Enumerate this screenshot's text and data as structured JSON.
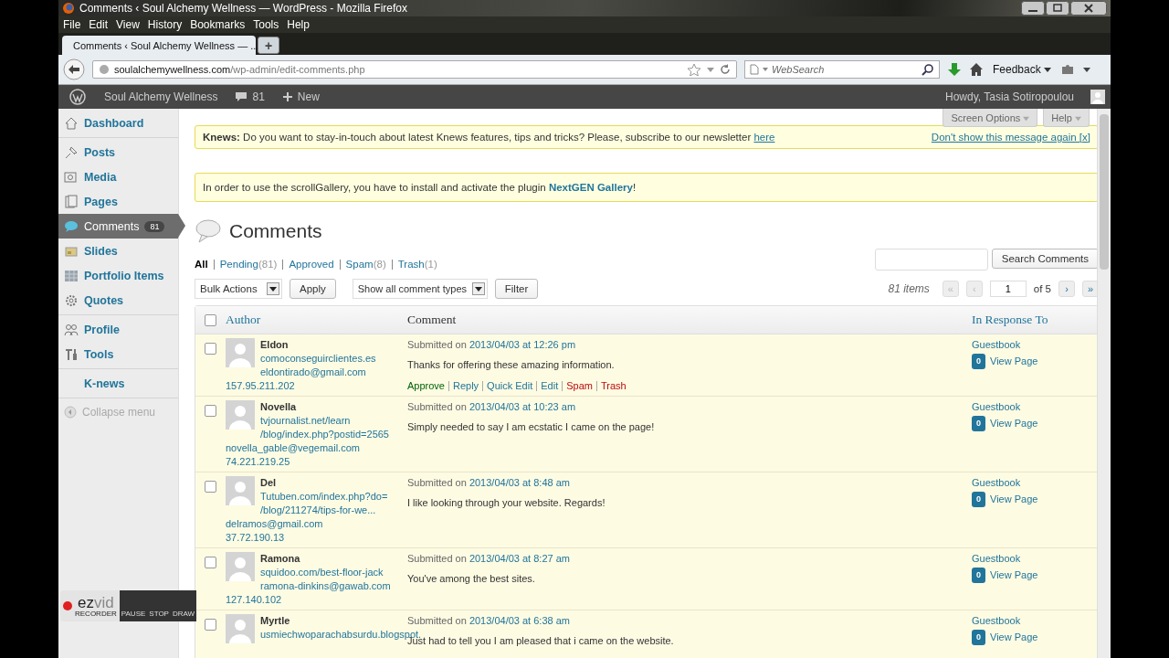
{
  "window": {
    "title": "Comments ‹ Soul Alchemy Wellness — WordPress - Mozilla Firefox"
  },
  "menu": [
    "File",
    "Edit",
    "View",
    "History",
    "Bookmarks",
    "Tools",
    "Help"
  ],
  "tabs": [
    {
      "label": "Comments ‹ Soul Alchemy Wellness — ...",
      "selected": true
    }
  ],
  "new_tab": "+",
  "address": {
    "host": "soulalchemywellness.com",
    "path": "/wp-admin/edit-comments.php"
  },
  "search": {
    "placeholder": "WebSearch"
  },
  "feedback": "Feedback",
  "admin_bar": {
    "site": "Soul Alchemy Wellness",
    "comments": "81",
    "new": "New",
    "greeting": "Howdy, Tasia Sotiropoulou"
  },
  "sidebar": {
    "groups": [
      [
        {
          "label": "Dashboard",
          "selected": false
        }
      ],
      [
        {
          "label": "Posts",
          "selected": false
        },
        {
          "label": "Media",
          "selected": false
        },
        {
          "label": "Pages",
          "selected": false
        },
        {
          "label": "Comments",
          "badge": "81",
          "selected": true
        },
        {
          "label": "Slides",
          "selected": false
        },
        {
          "label": "Portfolio Items",
          "selected": false
        },
        {
          "label": "Quotes",
          "selected": false
        }
      ],
      [
        {
          "label": "Profile",
          "selected": false
        },
        {
          "label": "Tools",
          "selected": false
        }
      ],
      [
        {
          "label": "K-news",
          "selected": false
        }
      ]
    ],
    "collapse": "Collapse menu"
  },
  "help_tabs": [
    "Screen Options",
    "Help"
  ],
  "notices": [
    {
      "kind": "knews",
      "label": "Knews:",
      "text": "Do you want to stay-in-touch about latest Knews features, tips and tricks? Please, subscribe to our newsletter",
      "link": "here",
      "dismiss": "Don't show this message again [x]"
    },
    {
      "kind": "plugin",
      "text": "In order to use the scrollGallery, you have to install and activate the plugin",
      "link": "NextGEN Gallery",
      "suffix": "!"
    }
  ],
  "heading": "Comments",
  "filters": [
    {
      "label": "All",
      "selected": true
    },
    {
      "label": "Pending",
      "count": "(81)",
      "selected": false
    },
    {
      "label": "Approved",
      "selected": false
    },
    {
      "label": "Spam",
      "count": "(8)",
      "selected": false
    },
    {
      "label": "Trash",
      "count": "(1)",
      "selected": false
    }
  ],
  "search_button": "Search Comments",
  "bulk": {
    "select": "Bulk Actions",
    "button": "Apply"
  },
  "type_filter": {
    "select": "Show all comment types",
    "button": "Filter"
  },
  "pagination": {
    "items": "81 items",
    "first": "«",
    "prev": "‹",
    "page": "1",
    "of": "of 5",
    "next": "›",
    "last": "»"
  },
  "table": {
    "checked": false,
    "columns": [
      "Author",
      "Comment",
      "In Response To"
    ],
    "rows": [
      {
        "checked": false,
        "name": "Eldon",
        "links": [
          "comoconseguirclientes.es",
          "eldontirado@gmail.com",
          "157.95.211.202"
        ],
        "submitted": "Submitted on",
        "date": "2013/04/03 at 12:26 pm",
        "text": "Thanks for offering these amazing information.",
        "actions": [
          {
            "label": "Approve",
            "kind": "approve"
          },
          {
            "label": "Reply",
            "kind": "normal"
          },
          {
            "label": "Quick Edit",
            "kind": "normal"
          },
          {
            "label": "Edit",
            "kind": "normal"
          },
          {
            "label": "Spam",
            "kind": "danger"
          },
          {
            "label": "Trash",
            "kind": "danger"
          }
        ],
        "response": "Guestbook",
        "bubble": "0",
        "view": "View Page"
      },
      {
        "checked": false,
        "name": "Novella",
        "links": [
          "tvjournalist.net/learn",
          "/blog/index.php?postid=2565",
          "novella_gable@vegemail.com",
          "74.221.219.25"
        ],
        "submitted": "Submitted on",
        "date": "2013/04/03 at 10:23 am",
        "text": "Simply needed to say I am ecstatic I came on the page!",
        "response": "Guestbook",
        "bubble": "0",
        "view": "View Page"
      },
      {
        "checked": false,
        "name": "Del",
        "links": [
          "Tutuben.com/index.php?do=",
          "/blog/211274/tips-for-we...",
          "delramos@gmail.com",
          "37.72.190.13"
        ],
        "submitted": "Submitted on",
        "date": "2013/04/03 at 8:48 am",
        "text": "I like looking through your website. Regards!",
        "response": "Guestbook",
        "bubble": "0",
        "view": "View Page"
      },
      {
        "checked": false,
        "name": "Ramona",
        "links": [
          "squidoo.com/best-floor-jack",
          "ramona-dinkins@gawab.com",
          "127.140.102"
        ],
        "submitted": "Submitted on",
        "date": "2013/04/03 at 8:27 am",
        "text": "You've among the best sites.",
        "response": "Guestbook",
        "bubble": "0",
        "view": "View Page"
      },
      {
        "checked": false,
        "name": "Myrtle",
        "links": [
          "usmiechwoparachabsurdu.blogspot."
        ],
        "submitted": "Submitted on",
        "date": "2013/04/03 at 6:38 am",
        "text": "Just had to tell you I am pleased that i came on the website.",
        "response": "Guestbook",
        "bubble": "0",
        "view": "View Page"
      }
    ]
  },
  "recorder": {
    "logo_a": "ez",
    "logo_b": "vid",
    "sub": "RECORDER",
    "buttons": [
      "PAUSE",
      "STOP",
      "DRAW"
    ]
  }
}
